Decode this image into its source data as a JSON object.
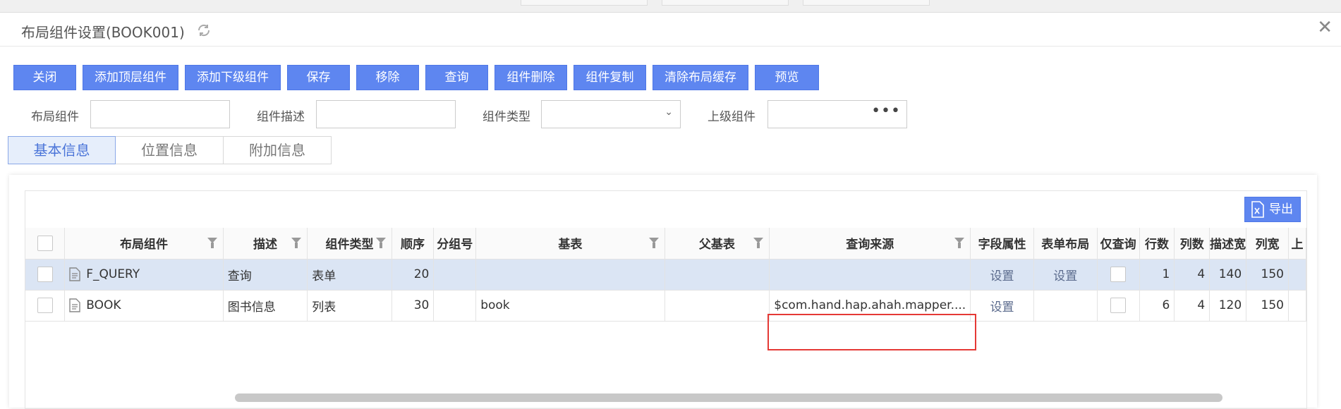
{
  "window": {
    "title": "布局组件设置(BOOK001)",
    "close_glyph": "✕"
  },
  "toolbar": {
    "buttons": [
      "关闭",
      "添加顶层组件",
      "添加下级组件",
      "保存",
      "移除",
      "查询",
      "组件删除",
      "组件复制",
      "清除布局缓存",
      "预览"
    ]
  },
  "filters": {
    "layout_component": {
      "label": "布局组件",
      "value": ""
    },
    "component_desc": {
      "label": "组件描述",
      "value": ""
    },
    "component_type": {
      "label": "组件类型",
      "value": ""
    },
    "parent_component": {
      "label": "上级组件",
      "value": ""
    }
  },
  "tabs": [
    "基本信息",
    "位置信息",
    "附加信息"
  ],
  "active_tab": "基本信息",
  "grid": {
    "export_label": "导出",
    "columns": [
      "布局组件",
      "描述",
      "组件类型",
      "顺序",
      "分组号",
      "基表",
      "父基表",
      "查询来源",
      "字段属性",
      "表单布局",
      "仅查询",
      "行数",
      "列数",
      "描述宽",
      "列宽",
      "上"
    ],
    "rows": [
      {
        "layout_component": "F_QUERY",
        "desc": "查询",
        "type": "表单",
        "order": "20",
        "group": "",
        "base_table": "",
        "parent_table": "",
        "query_source": "",
        "field_attr": "设置",
        "form_layout": "设置",
        "rows": "1",
        "cols": "4",
        "desc_width": "140",
        "col_width": "150"
      },
      {
        "layout_component": "BOOK",
        "desc": "图书信息",
        "type": "列表",
        "order": "30",
        "group": "",
        "base_table": "book",
        "parent_table": "",
        "query_source": "$com.hand.hap.ahah.mapper....",
        "field_attr": "设置",
        "form_layout": "",
        "rows": "6",
        "cols": "4",
        "desc_width": "120",
        "col_width": "150"
      }
    ]
  },
  "colors": {
    "primary": "#5e86f0",
    "selected_row": "#dbe5f4",
    "highlight_box": "#e53935"
  }
}
